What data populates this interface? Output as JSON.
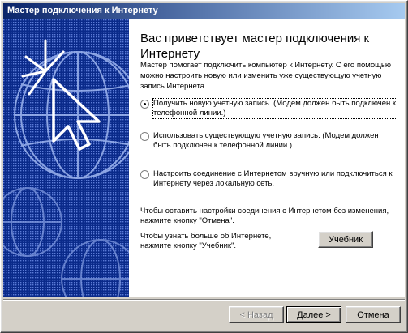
{
  "window": {
    "title": "Мастер подключения к Интернету"
  },
  "content": {
    "heading": "Вас приветствует мастер подключения к Интернету",
    "intro": "Мастер помогает подключить компьютер к Интернету. С его помощью можно настроить новую или изменить уже существующую учетную запись Интернета.",
    "options": [
      {
        "label": "Получить новую учетную запись. (Модем должен быть подключен к телефонной линии.)",
        "checked": true
      },
      {
        "label": "Использовать существующую учетную запись. (Модем должен быть подключен к телефонной линии.)",
        "checked": false
      },
      {
        "label": "Настроить соединение с Интернетом вручную или подключиться к Интернету через локальную сеть.",
        "checked": false
      }
    ],
    "cancel_note": "Чтобы оставить настройки соединения с Интернетом без изменения, нажмите кнопку \"Отмена\".",
    "tutorial_note": "Чтобы узнать больше об Интернете, нажмите кнопку \"Учебник\"."
  },
  "buttons": {
    "tutorial": "Учебник",
    "back": "< Назад",
    "next": "Далее >",
    "cancel": "Отмена"
  },
  "colors": {
    "titlebar_start": "#0a246a",
    "titlebar_end": "#a6caf0",
    "side_panel": "#0a2a8a",
    "face": "#d4d0c8"
  }
}
